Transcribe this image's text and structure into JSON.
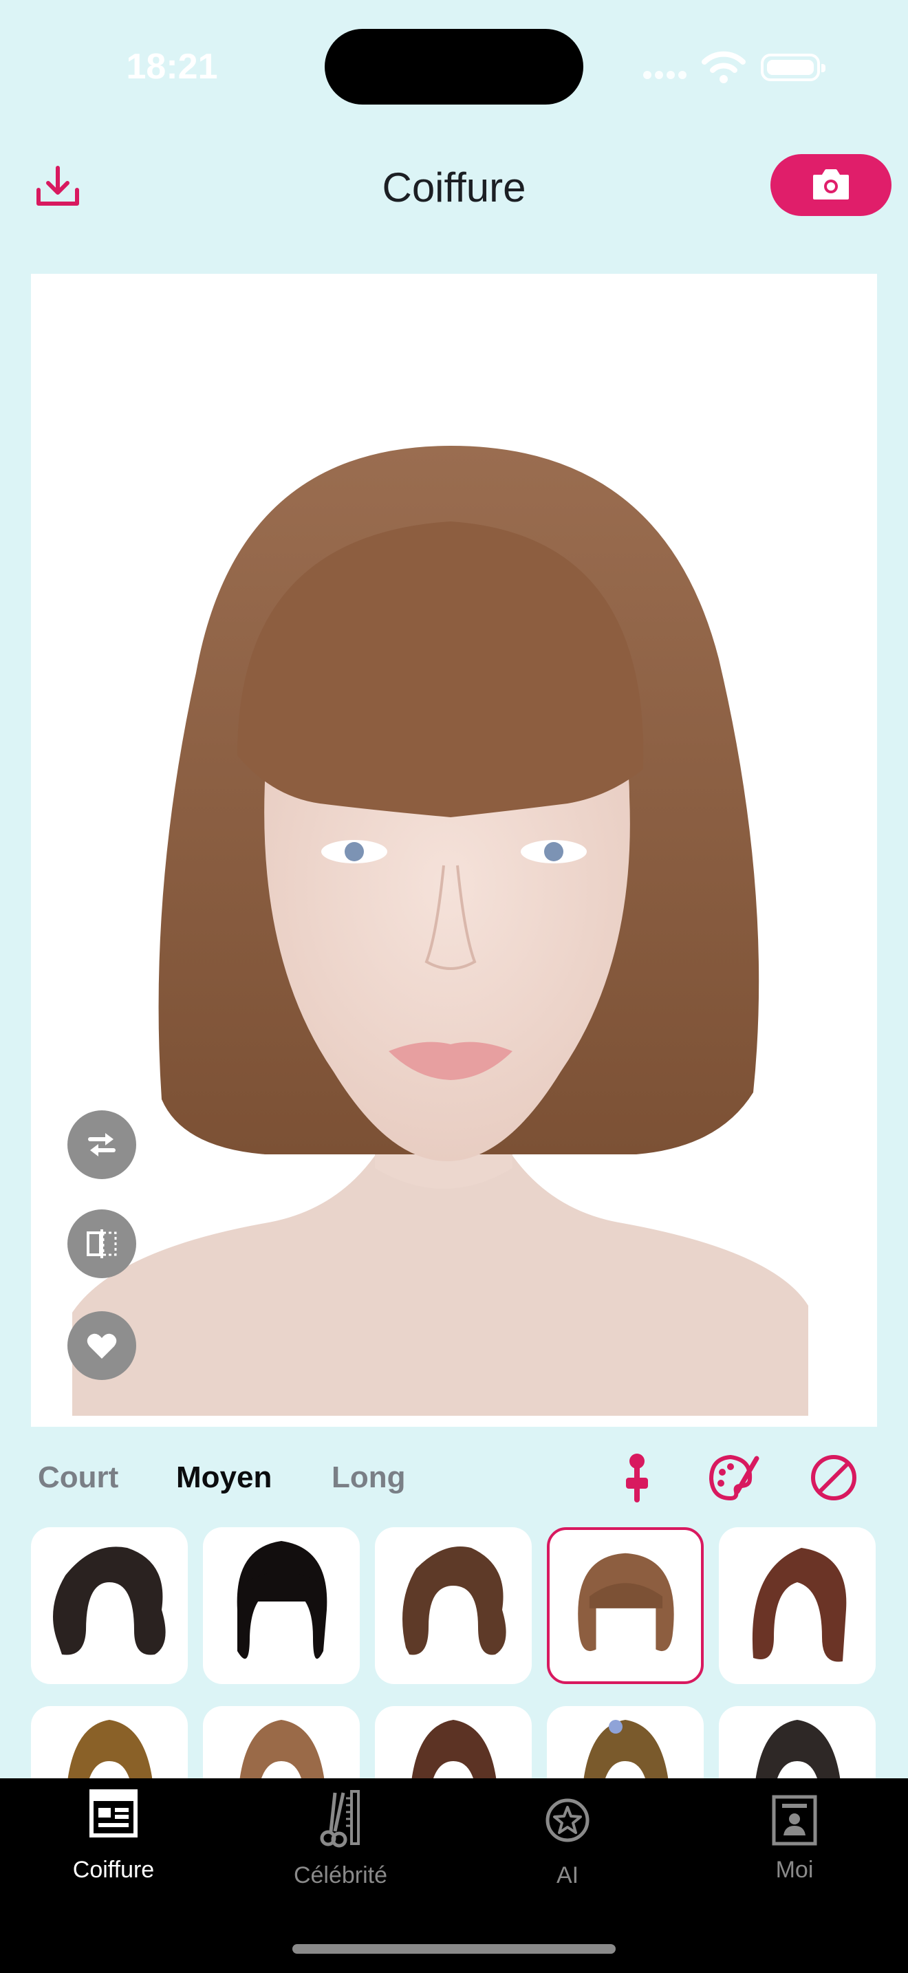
{
  "status_bar": {
    "time": "18:21"
  },
  "header": {
    "title": "Coiffure"
  },
  "categories": [
    {
      "label": "Court",
      "active": false
    },
    {
      "label": "Moyen",
      "active": true
    },
    {
      "label": "Long",
      "active": false
    }
  ],
  "colors": {
    "accent": "#e01e6a",
    "background": "#dcf4f6",
    "tab_bar": "#000000"
  },
  "icons": {
    "header_left": "download-icon",
    "header_right": "camera-icon",
    "photo_controls": [
      "swap-icon",
      "compare-icon",
      "favorite-icon"
    ],
    "tools": [
      "position-pin-icon",
      "palette-icon",
      "none-icon"
    ]
  },
  "hairstyle_grid": {
    "visible_rows": 2,
    "columns": 5,
    "selected_index": 3
  },
  "tabs": [
    {
      "label": "Coiffure",
      "icon": "layout-icon",
      "active": true
    },
    {
      "label": "Célébrité",
      "icon": "scissors-comb-icon",
      "active": false
    },
    {
      "label": "AI",
      "icon": "star-badge-icon",
      "active": false
    },
    {
      "label": "Moi",
      "icon": "profile-card-icon",
      "active": false
    }
  ]
}
